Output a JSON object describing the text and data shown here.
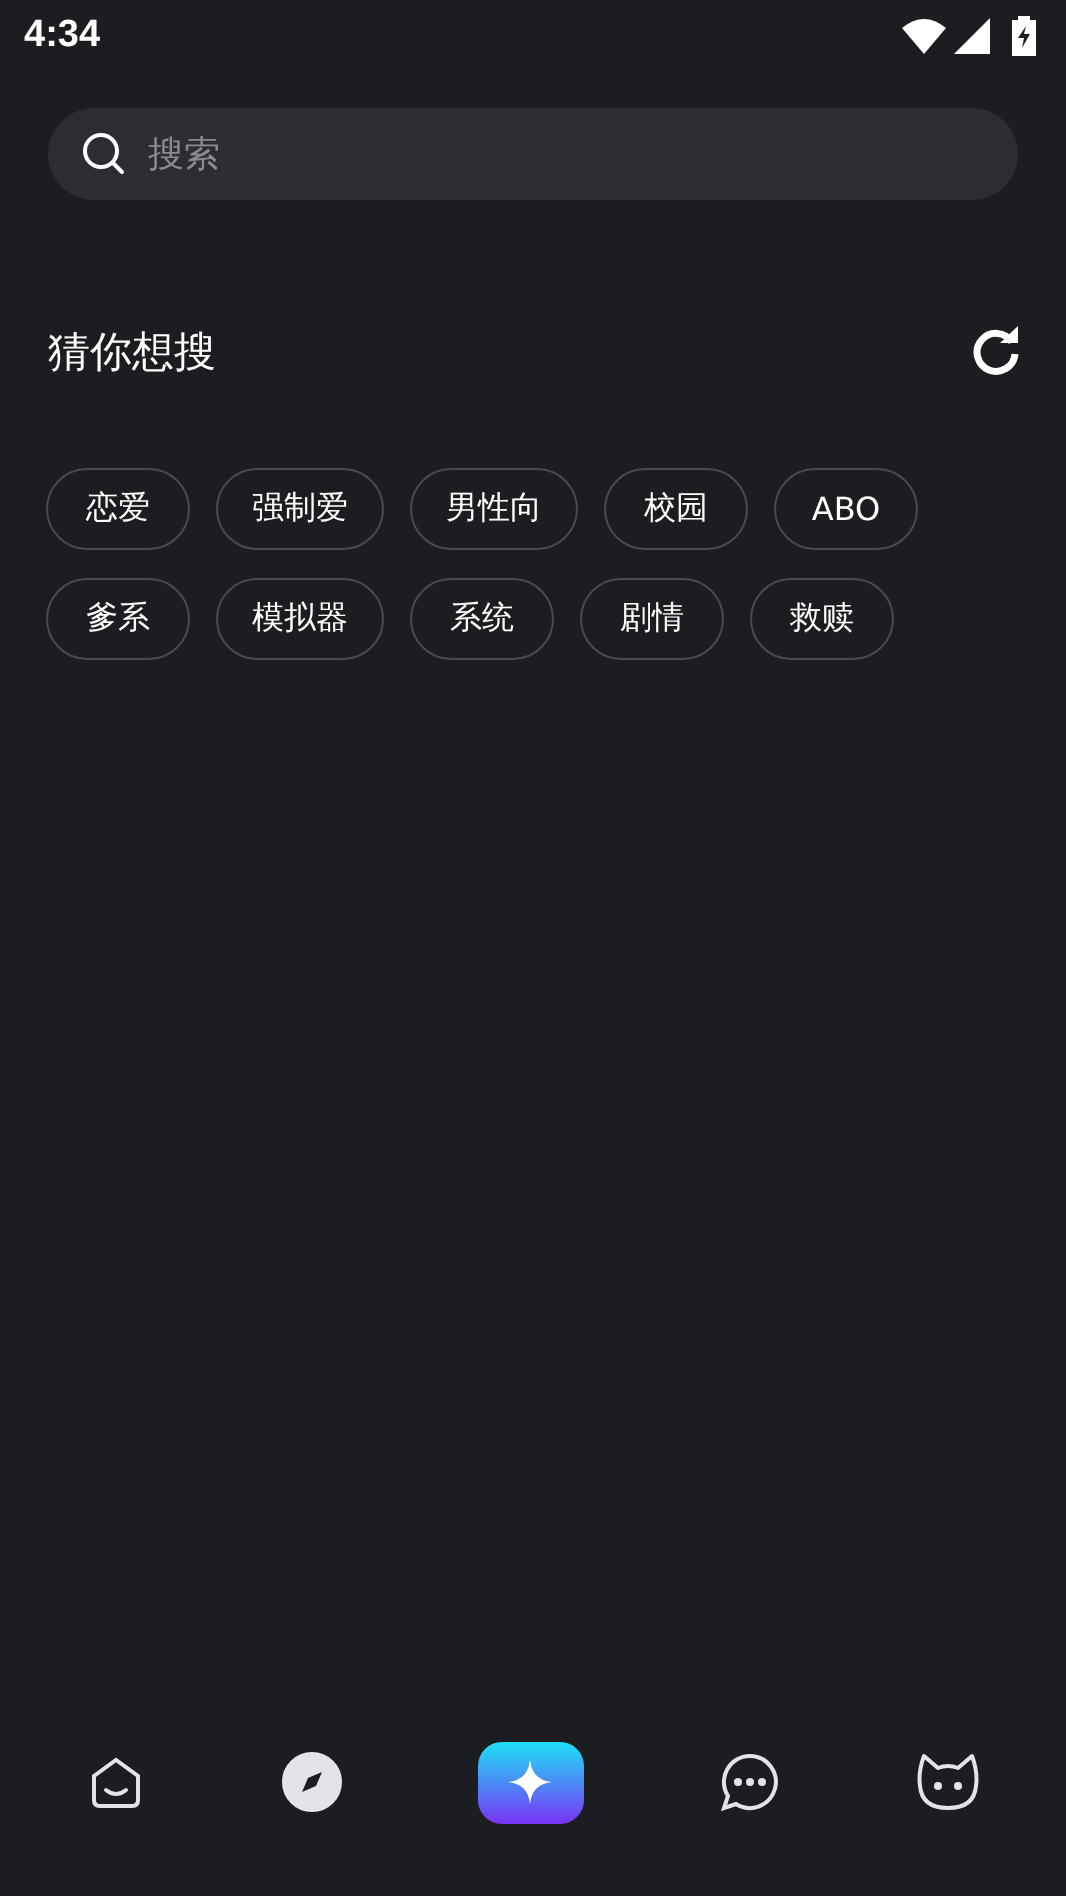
{
  "status_bar": {
    "time": "4:34"
  },
  "search": {
    "placeholder": "搜索"
  },
  "suggestions": {
    "title": "猜你想搜",
    "tags": [
      "恋爱",
      "强制爱",
      "男性向",
      "校园",
      "ABO",
      "爹系",
      "模拟器",
      "系统",
      "剧情",
      "救赎"
    ]
  },
  "nav": {
    "items": [
      {
        "kind": "home",
        "selected": false
      },
      {
        "kind": "discover",
        "selected": true
      },
      {
        "kind": "create",
        "selected": false
      },
      {
        "kind": "messages",
        "selected": false
      },
      {
        "kind": "profile",
        "selected": false
      }
    ]
  }
}
